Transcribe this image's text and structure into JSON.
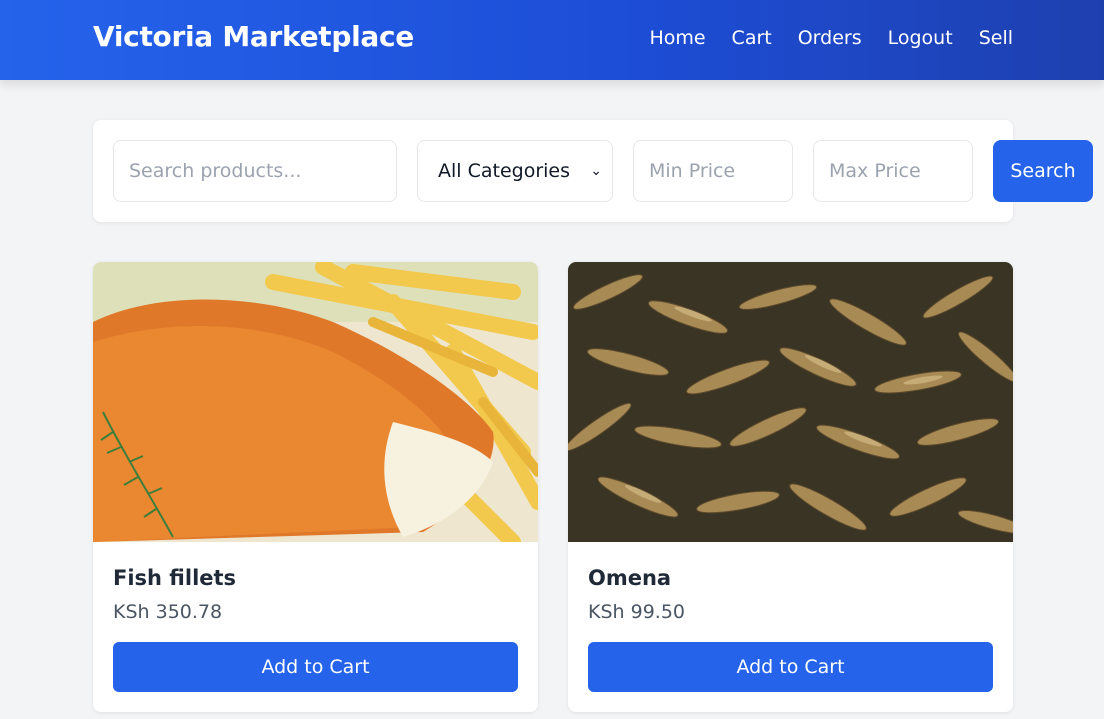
{
  "header": {
    "brand": "Victoria Marketplace",
    "nav": [
      "Home",
      "Cart",
      "Orders",
      "Logout",
      "Sell"
    ]
  },
  "filters": {
    "search_placeholder": "Search products...",
    "category_selected": "All Categories",
    "min_price_placeholder": "Min Price",
    "max_price_placeholder": "Max Price",
    "search_button": "Search"
  },
  "products": [
    {
      "name": "Fish fillets",
      "price": "KSh 350.78",
      "button": "Add to Cart",
      "image": "fried-fish-fillet-with-fries"
    },
    {
      "name": "Omena",
      "price": "KSh 99.50",
      "button": "Add to Cart",
      "image": "small-dried-fish"
    }
  ],
  "colors": {
    "primary": "#2563eb",
    "background": "#f3f4f6"
  }
}
